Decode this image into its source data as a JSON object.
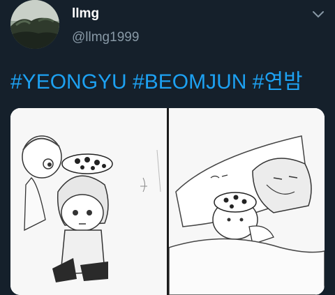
{
  "tweet": {
    "display_name": "llmg",
    "handle": "@llmg1999",
    "hashtags": [
      "#YEONGYU",
      "#BEOMJUN",
      "#연밤"
    ]
  },
  "media": {
    "panels": [
      {
        "id": "left",
        "content": "chibi drawing of two characters with leopard-print hat"
      },
      {
        "id": "right",
        "content": "drawing of character lying in bed holding a plush"
      }
    ]
  },
  "icons": {
    "caret": "chevron-down-icon"
  },
  "colors": {
    "background": "#15202b",
    "link": "#1da1f2",
    "name": "#ffffff",
    "secondary": "#8899a6"
  }
}
